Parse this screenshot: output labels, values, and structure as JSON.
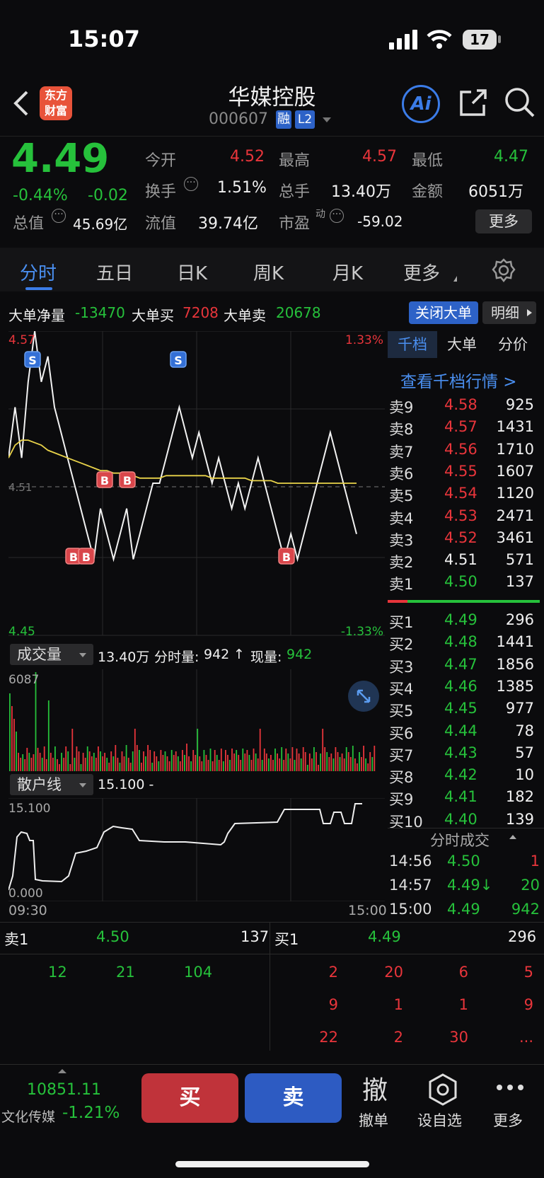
{
  "status": {
    "time": "15:07",
    "battery": "17"
  },
  "header": {
    "logo_line1": "东方",
    "logo_line2": "财富",
    "name": "华媒控股",
    "code": "000607",
    "tag1": "融",
    "tag2": "L2",
    "ai": "Ai"
  },
  "quote": {
    "price": "4.49",
    "pct": "-0.44%",
    "chg": "-0.02",
    "open_label": "今开",
    "open": "4.52",
    "high_label": "最高",
    "high": "4.57",
    "low_label": "最低",
    "low": "4.47",
    "turnover_label": "换手",
    "turnover": "1.51%",
    "vol_label": "总手",
    "vol": "13.40万",
    "amt_label": "金额",
    "amt": "6051万",
    "mcap_label": "总值",
    "mcap": "45.69亿",
    "float_label": "流值",
    "float": "39.74亿",
    "pe_label": "市盈",
    "pe_sup": "动",
    "pe": "-59.02",
    "more": "更多"
  },
  "tabs": [
    "分时",
    "五日",
    "日K",
    "周K",
    "月K",
    "更多"
  ],
  "bigorder": {
    "net_label": "大单净量",
    "net": "-13470",
    "buy_label": "大单买",
    "buy": "7208",
    "sell_label": "大单卖",
    "sell": "20678",
    "close_btn": "关闭大单",
    "detail_btn": "明细"
  },
  "chart_data": {
    "type": "line",
    "title": "分时",
    "price_axis": {
      "max": "4.57",
      "min": "4.45",
      "mid": "4.51",
      "pct_max": "1.33%",
      "pct_min": "-1.33%",
      "ylim": [
        4.45,
        4.57
      ]
    },
    "series": [
      {
        "values": [
          4.52,
          4.54,
          4.52,
          4.55,
          4.57,
          4.55,
          4.56,
          4.54,
          4.53,
          4.52,
          4.51,
          4.5,
          4.49,
          4.48,
          4.5,
          4.49,
          4.48,
          4.49,
          4.5,
          4.48,
          4.49,
          4.5,
          4.51,
          4.51,
          4.52,
          4.53,
          4.54,
          4.53,
          4.52,
          4.53,
          4.52,
          4.51,
          4.52,
          4.51,
          4.5,
          4.51,
          4.5,
          4.51,
          4.52,
          4.51,
          4.5,
          4.49,
          4.48,
          4.49,
          4.48,
          4.49,
          4.5,
          4.51,
          4.52,
          4.53,
          4.52,
          4.51,
          4.5,
          4.49
        ]
      },
      {
        "values": [
          4.52,
          4.525,
          4.527,
          4.527,
          4.526,
          4.525,
          4.523,
          4.522,
          4.521,
          4.52,
          4.519,
          4.518,
          4.517,
          4.516,
          4.515,
          4.515,
          4.514,
          4.514,
          4.513,
          4.513,
          4.512,
          4.512,
          4.512,
          4.512,
          4.513,
          4.513,
          4.513,
          4.513,
          4.513,
          4.513,
          4.513,
          4.512,
          4.512,
          4.512,
          4.512,
          4.512,
          4.512,
          4.511,
          4.511,
          4.511,
          4.511,
          4.51,
          4.51,
          4.51,
          4.51,
          4.51,
          4.51,
          4.51,
          4.51,
          4.51,
          4.51,
          4.51,
          4.51,
          4.51
        ]
      }
    ],
    "markers": [
      "S",
      "S",
      "B",
      "B",
      "B",
      "B",
      "B"
    ],
    "volume_max": "6087",
    "retail_label": "散户线",
    "retail_value": "15.100 -",
    "retail_max": "15.100",
    "retail_min": "0.000",
    "time_start": "09:30",
    "time_end": "15:00"
  },
  "volbar": {
    "label": "成交量",
    "total": "13.40万",
    "fen_label": "分时量:",
    "fen": "942",
    "arrow": "↑",
    "now_label": "现量:",
    "now": "942"
  },
  "ob": {
    "tabs": [
      "千档",
      "大单",
      "分价"
    ],
    "link": "查看千档行情 >",
    "asks": [
      {
        "l": "卖9",
        "p": "4.58",
        "v": "925"
      },
      {
        "l": "卖8",
        "p": "4.57",
        "v": "1431"
      },
      {
        "l": "卖7",
        "p": "4.56",
        "v": "1710"
      },
      {
        "l": "卖6",
        "p": "4.55",
        "v": "1607"
      },
      {
        "l": "卖5",
        "p": "4.54",
        "v": "1120"
      },
      {
        "l": "卖4",
        "p": "4.53",
        "v": "2471"
      },
      {
        "l": "卖3",
        "p": "4.52",
        "v": "3461"
      },
      {
        "l": "卖2",
        "p": "4.51",
        "v": "571"
      },
      {
        "l": "卖1",
        "p": "4.50",
        "v": "137"
      }
    ],
    "bids": [
      {
        "l": "买1",
        "p": "4.49",
        "v": "296"
      },
      {
        "l": "买2",
        "p": "4.48",
        "v": "1441"
      },
      {
        "l": "买3",
        "p": "4.47",
        "v": "1856"
      },
      {
        "l": "买4",
        "p": "4.46",
        "v": "1385"
      },
      {
        "l": "买5",
        "p": "4.45",
        "v": "977"
      },
      {
        "l": "买6",
        "p": "4.44",
        "v": "78"
      },
      {
        "l": "买7",
        "p": "4.43",
        "v": "57"
      },
      {
        "l": "买8",
        "p": "4.42",
        "v": "10"
      },
      {
        "l": "买9",
        "p": "4.41",
        "v": "182"
      },
      {
        "l": "买10",
        "p": "4.40",
        "v": "139"
      }
    ],
    "trades_label": "分时成交",
    "trades": [
      {
        "t": "14:56",
        "p": "4.50",
        "v": "1"
      },
      {
        "t": "14:57",
        "p": "4.49↓",
        "v": "20"
      },
      {
        "t": "15:00",
        "p": "4.49",
        "v": "942"
      }
    ]
  },
  "queue": {
    "sell_label": "卖1",
    "sell_price": "4.50",
    "sell_vol": "137",
    "buy_label": "买1",
    "buy_price": "4.49",
    "buy_vol": "296",
    "sell_items": [
      "12",
      "21",
      "104"
    ],
    "buy_items": [
      "2",
      "20",
      "6",
      "5",
      "9",
      "1",
      "1",
      "9",
      "22",
      "2",
      "30",
      "..."
    ]
  },
  "footer": {
    "index_value": "10851.11",
    "index_name": "文化传媒",
    "index_pct": "-1.21%",
    "buy": "买",
    "sell": "卖",
    "cancel_icon": "撤",
    "cancel": "撤单",
    "watch": "设自选",
    "more": "更多"
  }
}
